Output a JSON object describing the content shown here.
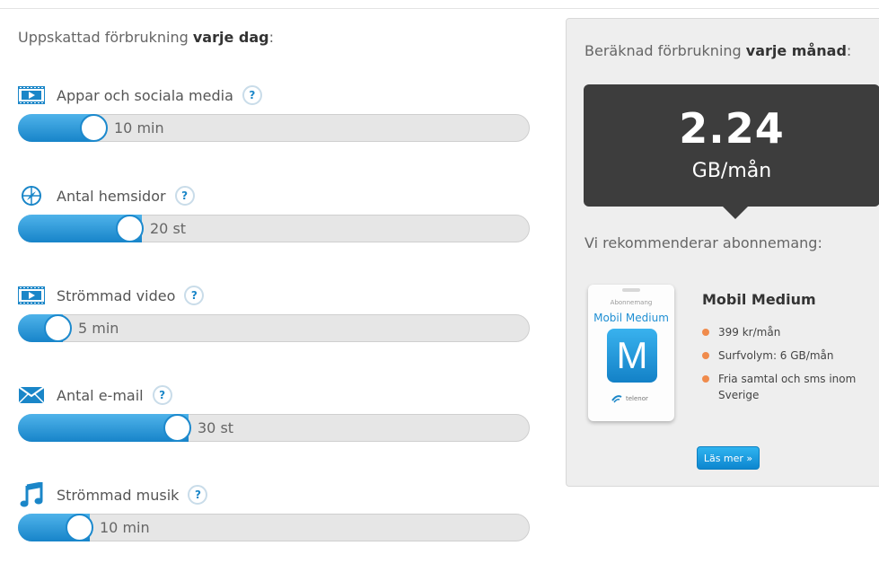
{
  "left_title": {
    "prefix": "Uppskattad förbrukning",
    "bold": "varje dag",
    "suffix": ":"
  },
  "sliders": [
    {
      "label": "Appar och sociala media",
      "value": "10 min",
      "icon": "film-icon",
      "level": 0.17
    },
    {
      "label": "Antal hemsidor",
      "value": "20 st",
      "icon": "compass-icon",
      "level": 0.24
    },
    {
      "label": "Strömmad video",
      "value": "5 min",
      "icon": "film-icon",
      "level": 0.08
    },
    {
      "label": "Antal e-mail",
      "value": "30 st",
      "icon": "envelope-icon",
      "level": 0.34
    },
    {
      "label": "Strömmad musik",
      "value": "10 min",
      "icon": "music-note-icon",
      "level": 0.14
    }
  ],
  "help_label": "?",
  "panel": {
    "title_prefix": "Beräknad förbrukning",
    "title_bold": "varje månad",
    "title_suffix": ":",
    "usage_value": "2.24",
    "usage_unit": "GB/mån",
    "recommend_text": "Vi rekommenderar abonnemang:",
    "product": {
      "box_sub": "Abonnemang",
      "box_name": "Mobil Medium",
      "box_letter": "M",
      "box_brand": "telenor",
      "name": "Mobil Medium",
      "features": [
        "399 kr/mån",
        "Surfvolym: 6 GB/mån",
        "Fria samtal och sms inom Sverige"
      ]
    },
    "more_button": "Läs mer »"
  },
  "colors": {
    "accent": "#1a86c8",
    "bullet": "#f08b4c",
    "result_bg": "#3d3d3d"
  }
}
